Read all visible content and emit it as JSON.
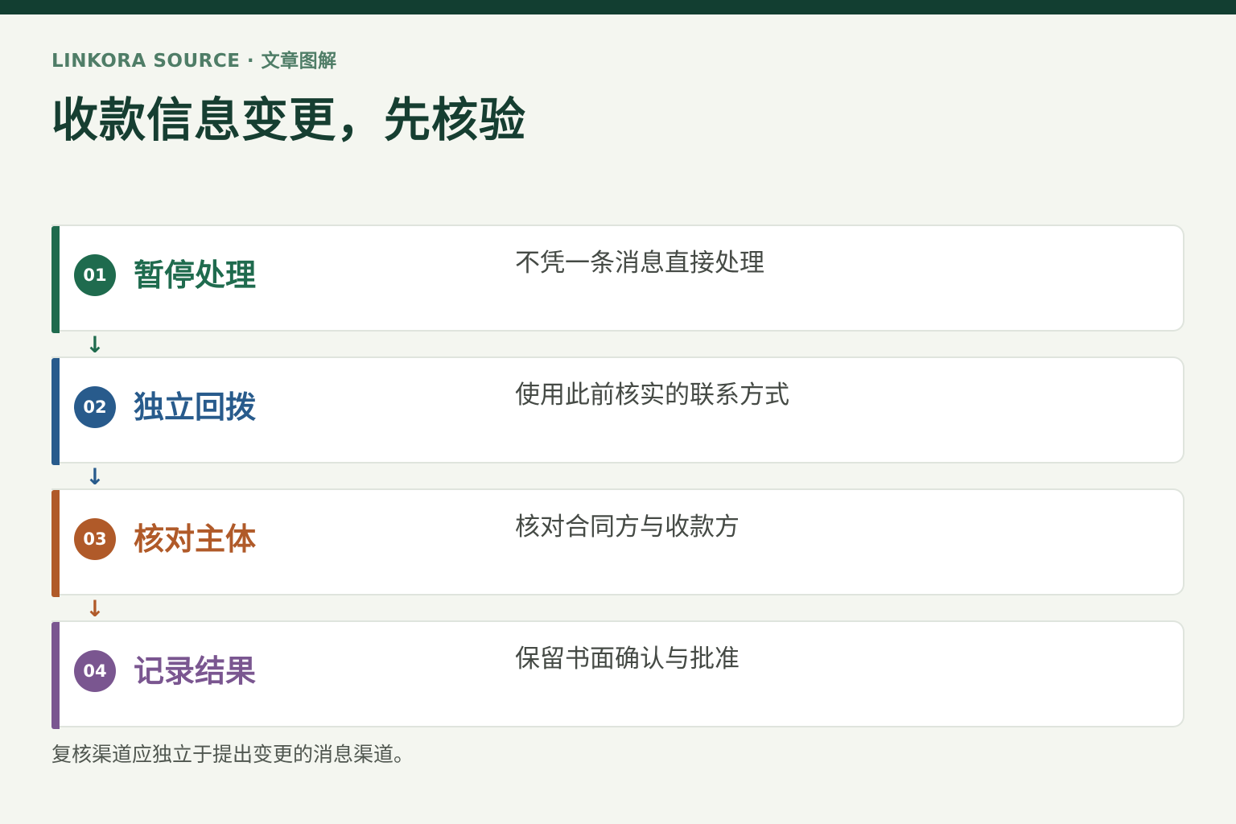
{
  "header": {
    "eyebrow": "LINKORA SOURCE · 文章图解",
    "title": "收款信息变更，先核验"
  },
  "steps": [
    {
      "number": "01",
      "title": "暂停处理",
      "description": "不凭一条消息直接处理",
      "color": "#1f6b4e"
    },
    {
      "number": "02",
      "title": "独立回拨",
      "description": "使用此前核实的联系方式",
      "color": "#285b8c"
    },
    {
      "number": "03",
      "title": "核对主体",
      "description": "核对合同方与收款方",
      "color": "#b05a29"
    },
    {
      "number": "04",
      "title": "记录结果",
      "description": "保留书面确认与批准",
      "color": "#7a5690"
    }
  ],
  "arrows": [
    "↓",
    "↓",
    "↓"
  ],
  "footnote": "复核渠道应独立于提出变更的消息渠道。",
  "colors": {
    "top_bar": "#123e31",
    "background": "#f4f6f0",
    "title": "#163e31",
    "eyebrow": "#4f7d67"
  }
}
